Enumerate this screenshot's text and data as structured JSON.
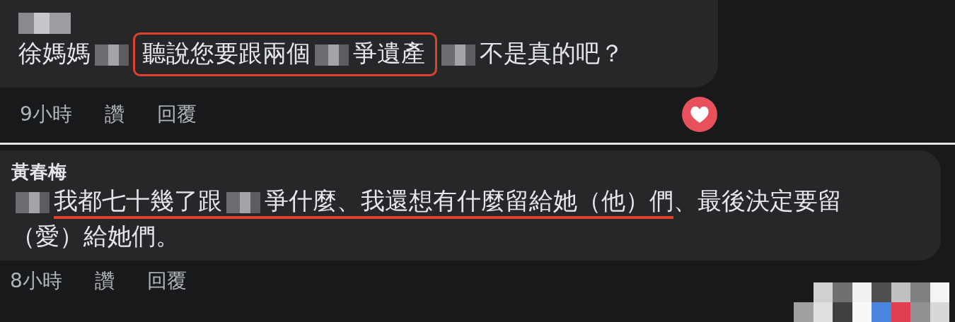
{
  "comments": [
    {
      "groups": [
        {
          "parts": [
            {
              "kind": "text",
              "text": "徐媽媽"
            },
            {
              "kind": "blur"
            }
          ]
        },
        {
          "boxed": true,
          "parts": [
            {
              "kind": "text",
              "text": "聽說您要跟兩個"
            },
            {
              "kind": "blur"
            },
            {
              "kind": "text",
              "text": "爭遺產"
            }
          ]
        },
        {
          "parts": [
            {
              "kind": "blur"
            },
            {
              "kind": "text",
              "text": "不是真的吧？"
            }
          ]
        }
      ],
      "time": "9小時",
      "actions": [
        "讚",
        "回覆"
      ],
      "heart": true
    },
    {
      "author": "黃春梅",
      "groups": [
        {
          "parts": [
            {
              "kind": "blur"
            }
          ]
        },
        {
          "underlined": true,
          "parts": [
            {
              "kind": "text",
              "text": "我都七十幾了跟"
            },
            {
              "kind": "blur"
            },
            {
              "kind": "text",
              "text": "爭什麼、我還想有什麼留給她（他）們"
            }
          ]
        },
        {
          "parts": [
            {
              "kind": "text",
              "text": "、最後決定要留"
            },
            {
              "kind": "text",
              "text": "（愛）給她們。"
            }
          ]
        }
      ],
      "time": "8小時",
      "actions": [
        "讚",
        "回覆"
      ]
    }
  ]
}
